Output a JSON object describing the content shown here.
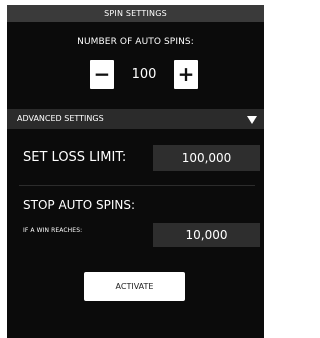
{
  "header": {
    "title": "SPIN SETTINGS"
  },
  "auto_spins": {
    "label": "NUMBER OF AUTO SPINS:",
    "decrement_symbol": "−",
    "increment_symbol": "+",
    "value": "100"
  },
  "advanced": {
    "label": "ADVANCED SETTINGS",
    "expand_icon": "triangle-down-icon"
  },
  "loss_limit": {
    "label": "SET LOSS LIMIT:",
    "value": "100,000"
  },
  "stop_auto_spins": {
    "label": "STOP AUTO SPINS:",
    "win_label": "IF A WIN REACHES:",
    "win_value": "10,000"
  },
  "activate": {
    "label": "ACTIVATE"
  },
  "colors": {
    "panel_bg": "#0b0b0b",
    "header_bg": "#3a3a3a",
    "field_bg": "#2e2e2e",
    "button_bg": "#ffffff"
  }
}
